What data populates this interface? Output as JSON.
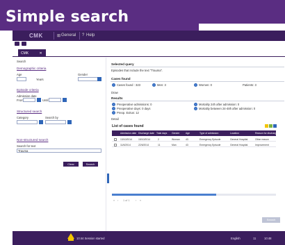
{
  "slide": {
    "title": "Simple search"
  },
  "menu": {
    "logo": "CMK",
    "items": [
      "General",
      "Help"
    ]
  },
  "tab": {
    "label": "CMK"
  },
  "left": {
    "search_label": "Search",
    "demographic_title": "Demographic criteria",
    "age_label": "Age",
    "years_label": "Years",
    "gender_label": "Gender",
    "episode_title": "Episode criteria",
    "admission_label": "Admission date",
    "from_label": "From",
    "until_label": "Until",
    "structured_title": "Structured search",
    "category_label": "Category",
    "search_by_label": "Search by",
    "nonstructured_title": "Non-structured search",
    "search_text_label": "Search for text",
    "search_text_value": "Trauma",
    "clear_label": "Clear",
    "search_label_btn": "Search"
  },
  "right": {
    "selected_query_title": "Selected query",
    "selected_query_text": "Episodes that include the text \"Trauma\".",
    "cases_found_title": "Cases found",
    "cases_found": "Cases found : 323",
    "men": "Men: 3",
    "women": "Women: 0",
    "patients": "Patients: 3",
    "draw_label": "Draw",
    "results_title": "Results",
    "results": {
      "left": [
        "Preoperative admissions: 0",
        "Preoperative days: 0 days",
        "Preop. Exitus: 12"
      ],
      "right": [
        "Mortality 24h after admission: 0",
        "Mortality between 24-48h after admission: 0"
      ]
    },
    "detail_label": "Detail",
    "list_title": "List of cases found",
    "table": {
      "headers": [
        "Admission date",
        "Discharge date",
        "Total days",
        "Gender",
        "Age",
        "Type of admission",
        "Location",
        "Reason for discharge"
      ],
      "rows": [
        [
          "13/10/2014",
          "15/10/2014",
          "2",
          "Woman",
          "43",
          "Emergency Episode",
          "General Hospital",
          "Other reason"
        ],
        [
          "11/6/2014",
          "22/6/2014",
          "11",
          "Man",
          "43",
          "Emergency Episode",
          "General Hospital",
          "Improvement"
        ]
      ]
    },
    "pager": "1 of 1",
    "search_btn": "Search"
  },
  "status": {
    "session_text": "10:44 Session started",
    "language": "English",
    "num": "11",
    "time": "10:48"
  },
  "colors": {
    "header": "#5a2d82",
    "frame": "#3b1e5d",
    "accent": "#2f66b8",
    "warning": "#f2c400"
  }
}
